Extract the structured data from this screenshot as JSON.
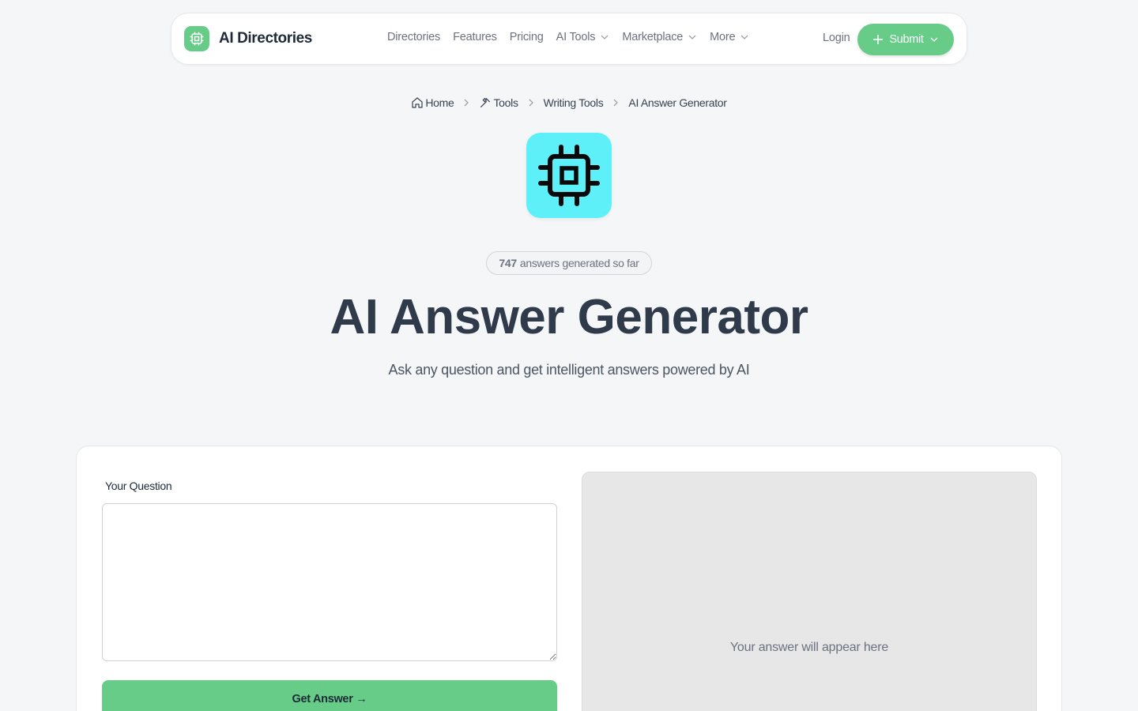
{
  "brand": {
    "name": "AI Directories",
    "accent_color": "#66cc88",
    "icon": "chip-icon"
  },
  "nav": {
    "links": [
      {
        "label": "Directories",
        "dropdown": false
      },
      {
        "label": "Features",
        "dropdown": false
      },
      {
        "label": "Pricing",
        "dropdown": false
      },
      {
        "label": "AI Tools",
        "dropdown": true
      },
      {
        "label": "Marketplace",
        "dropdown": true
      },
      {
        "label": "More",
        "dropdown": true
      }
    ],
    "login_label": "Login",
    "submit_label": "Submit"
  },
  "breadcrumb": {
    "items": [
      {
        "label": "Home",
        "icon": "home-icon"
      },
      {
        "label": "Tools",
        "icon": "tools-icon"
      },
      {
        "label": "Writing Tools"
      },
      {
        "label": "AI Answer Generator"
      }
    ]
  },
  "hero": {
    "icon": "chip-icon",
    "icon_bg": "#5ef0f8",
    "counter_value": "747",
    "counter_text": "answers generated so far",
    "title": "AI Answer Generator",
    "subtitle": "Ask any question and get intelligent answers powered by AI"
  },
  "form": {
    "question_label": "Your Question",
    "question_value": "",
    "button_label": "Get Answer →",
    "answer_placeholder": "Your answer will appear here"
  }
}
